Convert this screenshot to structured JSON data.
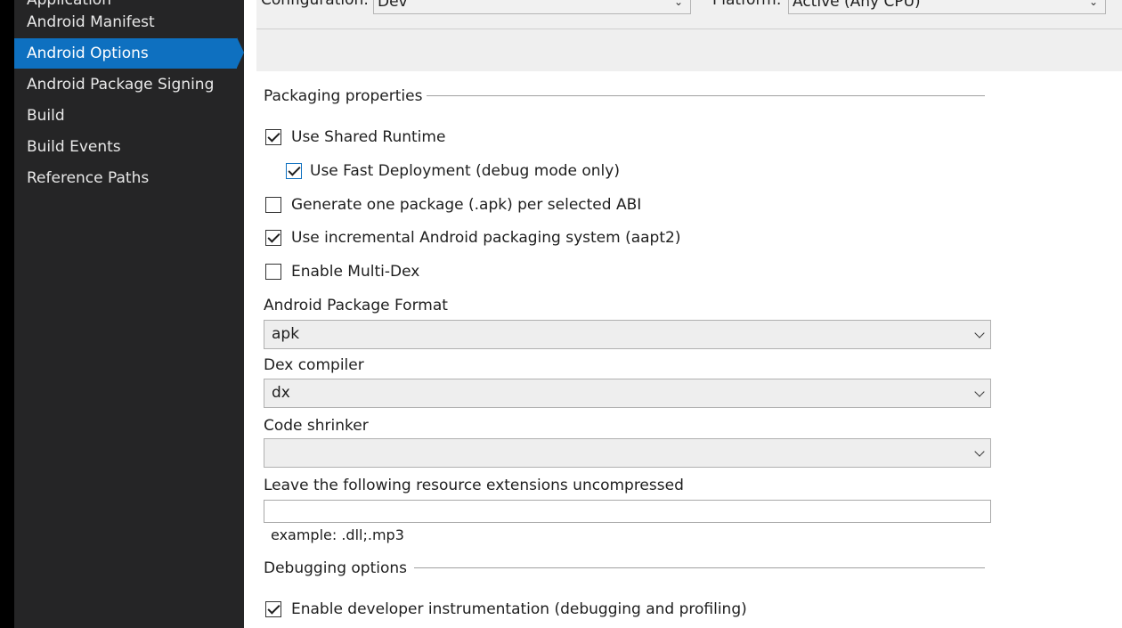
{
  "sidebar": {
    "items": [
      {
        "label": "Application",
        "active": false
      },
      {
        "label": "Android Manifest",
        "active": false
      },
      {
        "label": "Android Options",
        "active": true
      },
      {
        "label": "Android Package Signing",
        "active": false
      },
      {
        "label": "Build",
        "active": false
      },
      {
        "label": "Build Events",
        "active": false
      },
      {
        "label": "Reference Paths",
        "active": false
      }
    ]
  },
  "topbar": {
    "configuration_label": "Configuration:",
    "configuration_value": "Dev",
    "platform_label": "Platform:",
    "platform_value": "Active (Any CPU)"
  },
  "packaging": {
    "header": "Packaging properties",
    "options": [
      {
        "label": "Use Shared Runtime",
        "checked": true
      },
      {
        "label": "Use Fast Deployment (debug mode only)",
        "checked": true
      },
      {
        "label": "Generate one package (.apk) per selected ABI",
        "checked": false
      },
      {
        "label": "Use incremental Android packaging system (aapt2)",
        "checked": true
      },
      {
        "label": "Enable Multi-Dex",
        "checked": false
      }
    ],
    "package_format_label": "Android Package Format",
    "package_format_value": "apk",
    "dex_compiler_label": "Dex compiler",
    "dex_compiler_value": "dx",
    "code_shrinker_label": "Code shrinker",
    "code_shrinker_value": "",
    "uncompressed_label": "Leave the following resource extensions uncompressed",
    "uncompressed_value": "",
    "uncompressed_hint": "example: .dll;.mp3"
  },
  "debugging": {
    "header": "Debugging options",
    "options": [
      {
        "label": "Enable developer instrumentation (debugging and profiling)",
        "checked": true
      }
    ]
  },
  "colors": {
    "accent": "#0e70c0",
    "sidebar_bg": "#252526"
  }
}
